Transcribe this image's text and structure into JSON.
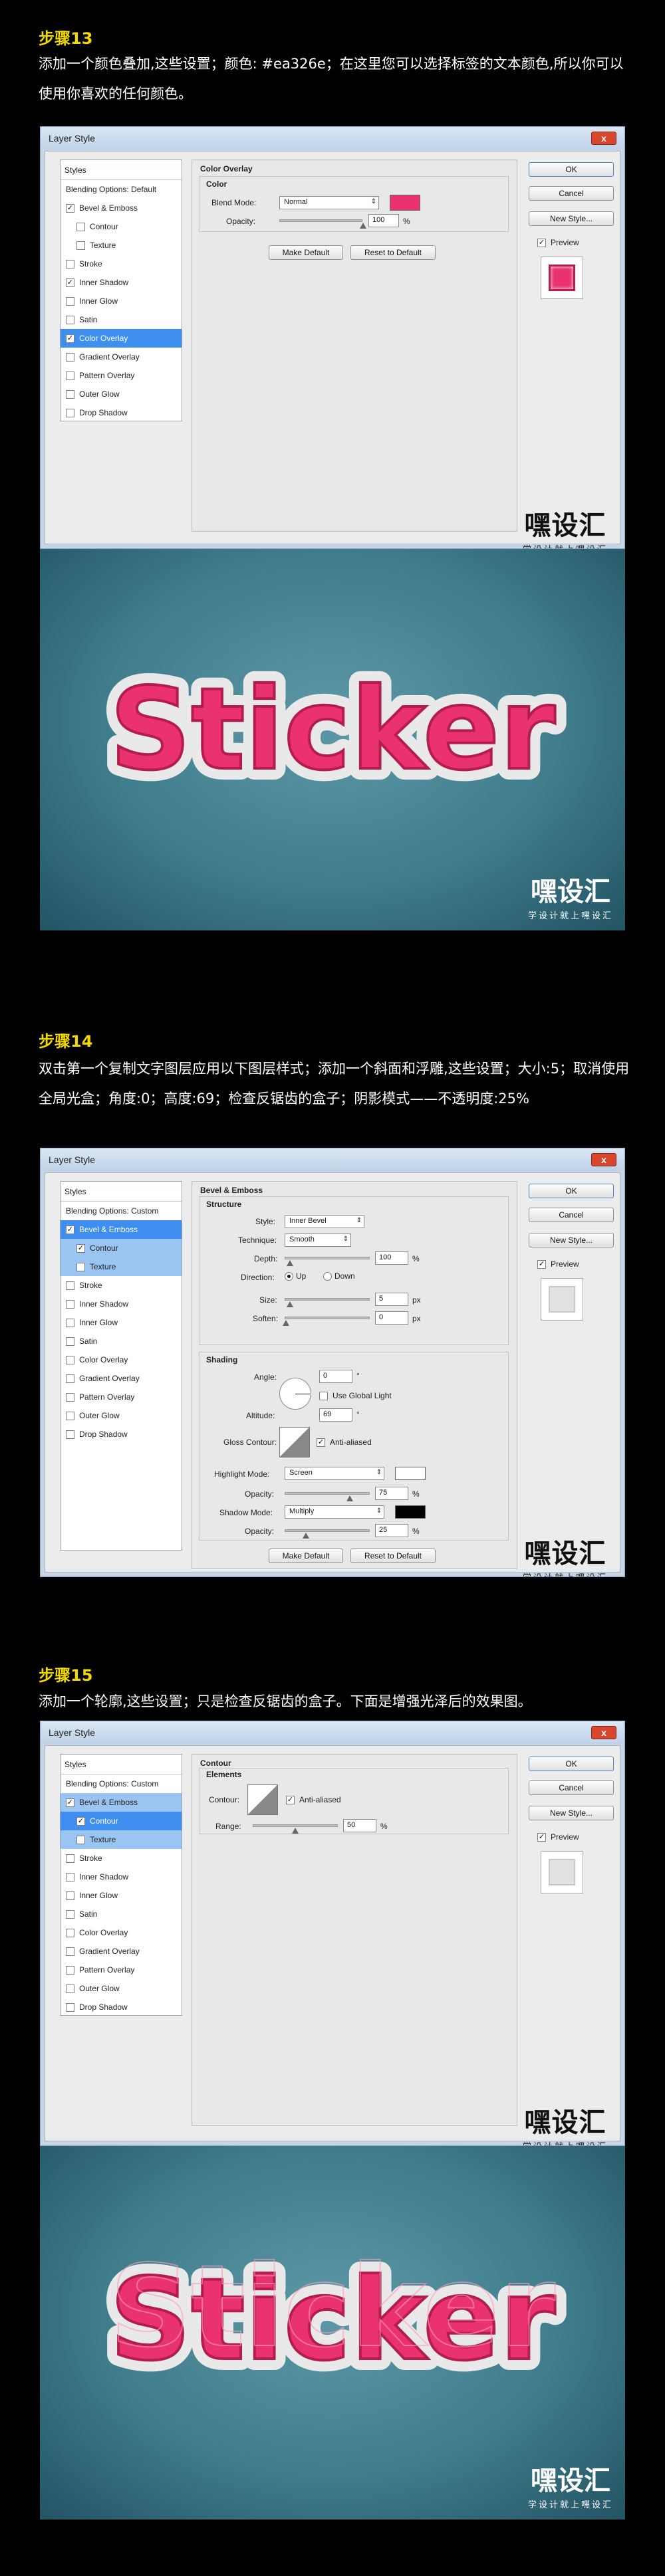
{
  "steps": [
    {
      "title": "步骤13",
      "desc": "添加一个颜色叠加,这些设置；颜色: #ea326e；在这里您可以选择标签的文本颜色,所以你可以使用你喜欢的任何颜色。"
    },
    {
      "title": "步骤14",
      "desc": "双击第一个复制文字图层应用以下图层样式；添加一个斜面和浮雕,这些设置；大小:5；取消使用全局光盒；角度:0；高度:69；检查反锯齿的盒子；阴影模式——不透明度:25%"
    },
    {
      "title": "步骤15",
      "desc": "添加一个轮廓,这些设置；只是检查反锯齿的盒子。下面是增强光泽后的效果图。"
    }
  ],
  "dialog": {
    "title": "Layer Style",
    "close": "x",
    "ok": "OK",
    "cancel": "Cancel",
    "new_style": "New Style...",
    "preview": "Preview",
    "make_default": "Make Default",
    "reset_default": "Reset to Default"
  },
  "styles": {
    "header": "Styles",
    "blend_default": "Blending Options: Default",
    "blend_custom": "Blending Options: Custom",
    "items": [
      "Bevel & Emboss",
      "Contour",
      "Texture",
      "Stroke",
      "Inner Shadow",
      "Inner Glow",
      "Satin",
      "Color Overlay",
      "Gradient Overlay",
      "Pattern Overlay",
      "Outer Glow",
      "Drop Shadow"
    ]
  },
  "color_overlay": {
    "section": "Color Overlay",
    "group": "Color",
    "blend_mode_label": "Blend Mode:",
    "blend_mode": "Normal",
    "opacity_label": "Opacity:",
    "opacity": "100",
    "unit": "%",
    "swatch": "#ea326e",
    "opacity_pct": 1.0
  },
  "bevel": {
    "section": "Bevel & Emboss",
    "structure": "Structure",
    "style_label": "Style:",
    "style": "Inner Bevel",
    "technique_label": "Technique:",
    "technique": "Smooth",
    "depth_label": "Depth:",
    "depth": "100",
    "direction_label": "Direction:",
    "up": "Up",
    "down": "Down",
    "size_label": "Size:",
    "size": "5",
    "soften_label": "Soften:",
    "soften": "0",
    "px": "px",
    "pct": "%",
    "shading": "Shading",
    "angle_label": "Angle:",
    "angle": "0",
    "deg": "°",
    "global_light": "Use Global Light",
    "altitude_label": "Altitude:",
    "altitude": "69",
    "gloss_label": "Gloss Contour:",
    "anti_aliased": "Anti-aliased",
    "highlight_label": "Highlight Mode:",
    "highlight": "Screen",
    "hl_opacity": "75",
    "shadow_label": "Shadow Mode:",
    "shadow": "Multiply",
    "sh_opacity": "25",
    "opacity_label": "Opacity:",
    "highlight_color": "#ffffff",
    "shadow_color": "#000000"
  },
  "contour": {
    "section": "Contour",
    "group": "Elements",
    "contour_label": "Contour:",
    "anti_aliased": "Anti-aliased",
    "range_label": "Range:",
    "range": "50",
    "pct": "%"
  },
  "watermark": {
    "big": "嘿设汇",
    "small": "学设计就上嘿设汇"
  },
  "art": {
    "text": "Sticker",
    "fill": "#ea326e",
    "bg": "#4a8494"
  }
}
